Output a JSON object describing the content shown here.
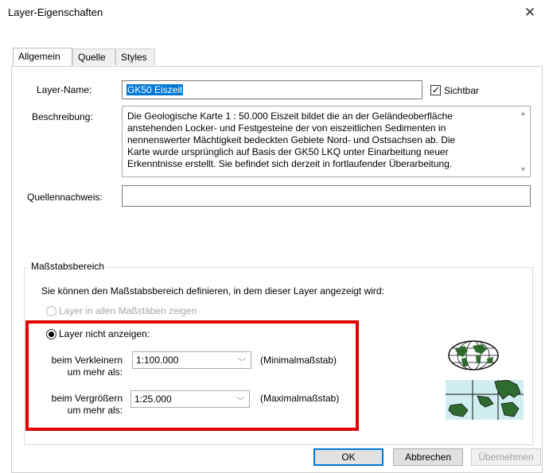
{
  "window": {
    "title": "Layer-Eigenschaften",
    "close_glyph": "✕"
  },
  "tabs": [
    {
      "label": "Allgemein"
    },
    {
      "label": "Quelle"
    },
    {
      "label": "Styles"
    }
  ],
  "general": {
    "layer_name_label": "Layer-Name:",
    "layer_name_value": "GK50 Eiszeit",
    "visible_label": "Sichtbar",
    "visible_checked": true,
    "description_label": "Beschreibung:",
    "description_lines": [
      "Die Geologische Karte 1 : 50.000 Eiszeit bildet die an der Geländeoberfläche",
      "anstehenden Locker- und Festgesteine der von eiszeitlichen Sedimenten in",
      "nennenswerter Mächtigkeit bedeckten Gebiete Nord- und Ostsachsen ab. Die",
      "Karte wurde ursprünglich auf Basis der GK50 LKQ unter Einarbeitung neuer",
      "Erkenntnisse erstellt. Sie befindet sich derzeit in fortlaufender Überarbeitung."
    ],
    "source_label": "Quellennachweis:",
    "source_value": ""
  },
  "scale_range": {
    "legend": "Maßstabsbereich",
    "intro": "Sie können den Maßstabsbereich definieren, in dem dieser Layer angezeigt wird:",
    "option_all": "Layer in allen Maßstäben zeigen",
    "option_hide": "Layer nicht anzeigen:",
    "selected_option": "hide",
    "min_label_1": "beim Verkleinern",
    "min_label_2": "um mehr als:",
    "min_value": "1:100.000",
    "min_note": "(Minimalmaßstab)",
    "max_label_1": "beim Vergrößern",
    "max_label_2": "um mehr als:",
    "max_value": "1:25.000",
    "max_note": "(Maximalmaßstab)"
  },
  "buttons": {
    "ok": "OK",
    "cancel": "Abbrechen",
    "apply": "Übernehmen"
  },
  "icons": {
    "close": "close-icon",
    "min_scale": "globe-icon",
    "max_scale": "map-detail-icon",
    "dropdown": "chevron-down-icon"
  },
  "colors": {
    "selection": "#0078d7",
    "highlight_box": "#e00000"
  }
}
